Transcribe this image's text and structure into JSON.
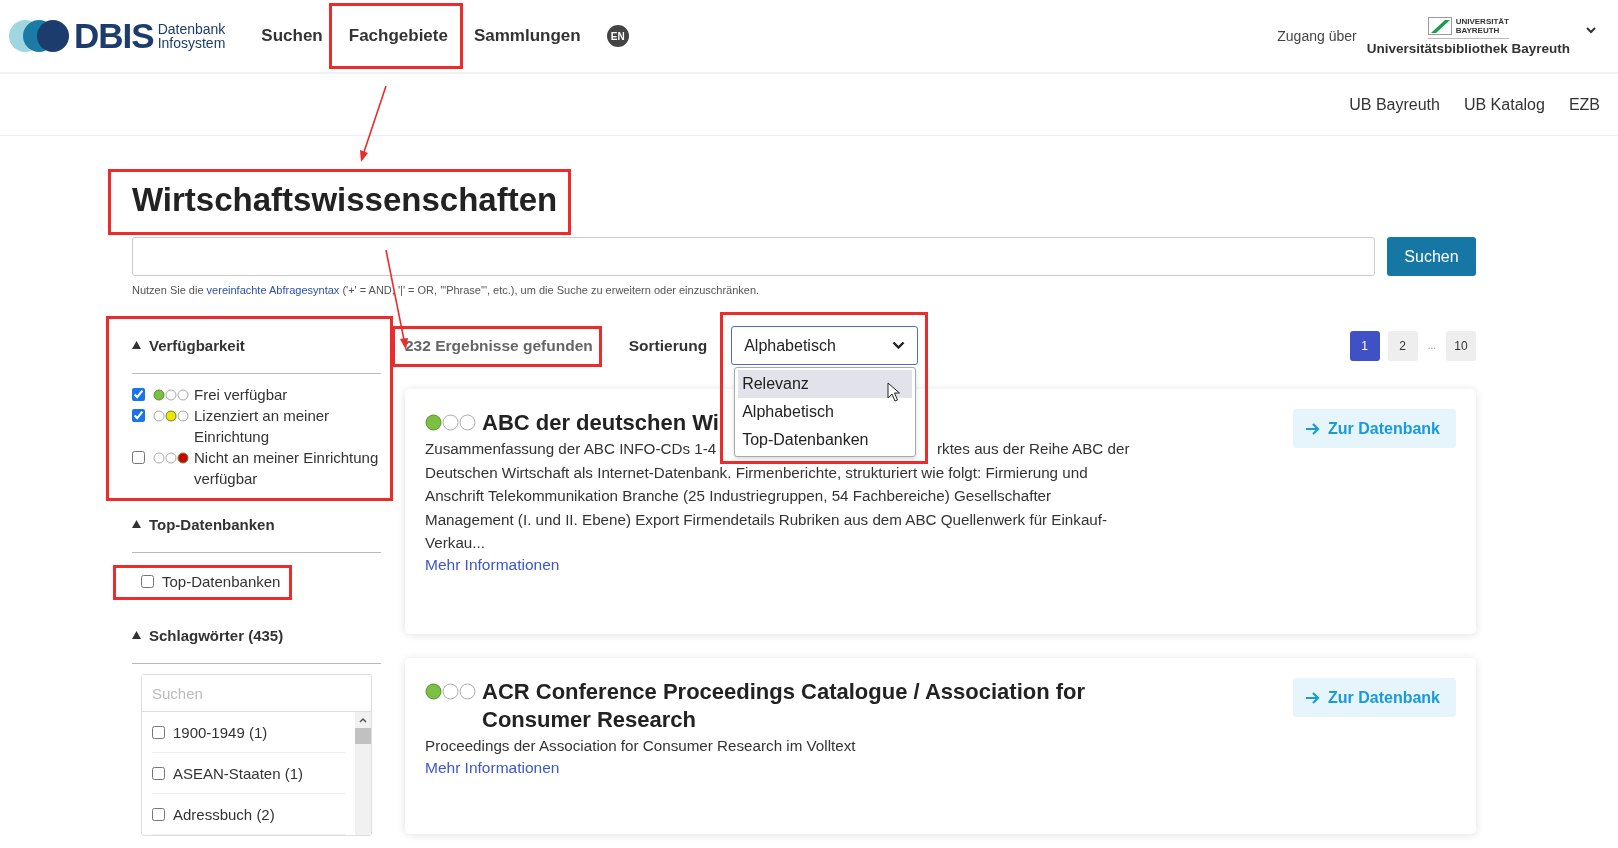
{
  "header": {
    "logo": {
      "name": "DBIS",
      "subtitle_lines": [
        "Datenbank",
        "Infosystem"
      ]
    },
    "nav": [
      {
        "label": "Suchen",
        "highlighted": false
      },
      {
        "label": "Fachgebiete",
        "highlighted": true
      },
      {
        "label": "Sammlungen",
        "highlighted": false
      }
    ],
    "language": "EN",
    "access": {
      "label": "Zugang über",
      "institution": "Universitätsbibliothek Bayreuth",
      "logo_lines": [
        "UNIVERSITÄT",
        "BAYREUTH"
      ]
    }
  },
  "subnav": [
    "UB Bayreuth",
    "UB Katalog",
    "EZB"
  ],
  "title": {
    "text": "Wirtschaftswissenschaften",
    "highlighted": true
  },
  "search": {
    "button": "Suchen",
    "hint": {
      "before": "Nutzen Sie die",
      "link": "vereinfachte Abfragesyntax",
      "after": "('+' = AND, '|' = OR, '\"Phrase\"', etc.), um die Suche zu erweitern oder einzuschränken."
    }
  },
  "filters": [
    {
      "kind": "availability",
      "title": "Verfügbarkeit",
      "expanded": true,
      "highlighted": true,
      "options": [
        {
          "label": "Frei verfügbar",
          "kind": "free",
          "checked": true
        },
        {
          "label": "Lizenziert an meiner Einrichtung",
          "kind": "licensed",
          "checked": true
        },
        {
          "label": "Nicht an meiner Einrichtung verfügbar",
          "kind": "none",
          "checked": false
        }
      ]
    },
    {
      "kind": "checkbox",
      "title": "Top-Datenbanken",
      "expanded": true,
      "highlighted": false,
      "options": [
        {
          "label": "Top-Datenbanken",
          "checked": false,
          "highlighted": true
        }
      ]
    },
    {
      "kind": "searchable-list",
      "title": "Schlagwörter (435)",
      "expanded": true,
      "highlighted": false,
      "placeholder": "Suchen",
      "options": [
        {
          "label": "1900-1949 (1)",
          "checked": false
        },
        {
          "label": "ASEAN-Staaten (1)",
          "checked": false
        },
        {
          "label": "Adressbuch (2)",
          "checked": false
        }
      ]
    }
  ],
  "results": {
    "count": "232 Ergebnisse gefunden",
    "highlighted": true
  },
  "sort": {
    "label": "Sortierung",
    "value": "Alphabetisch",
    "open": true,
    "highlighted": true,
    "options": [
      {
        "label": "Relevanz",
        "hovered": true
      },
      {
        "label": "Alphabetisch",
        "hovered": false
      },
      {
        "label": "Top-Datenbanken",
        "hovered": false
      }
    ]
  },
  "pagination": [
    {
      "kind": "page",
      "label": "1",
      "selected": true
    },
    {
      "kind": "page",
      "label": "2",
      "selected": false
    },
    {
      "kind": "ellipsis",
      "label": "..."
    },
    {
      "kind": "page",
      "label": "10",
      "selected": false
    }
  ],
  "databases": [
    {
      "kind": "free",
      "title": "ABC der deutschen Wi",
      "lines": [
        [
          "Zusammenfassung der ABC INFO-CDs 1-4",
          "rktes aus der Reihe ABC der"
        ],
        [
          "Deutschen Wirtschaft als Internet-Datenbank. Firmenberichte, strukturiert wie folgt: Firmierung und"
        ],
        [
          "Anschrift Telekommunikation Branche (25 Industriegruppen, 54 Fachbereiche) Gesellschafter"
        ],
        [
          "Management (I. und II. Ebene) Export Firmendetails Rubriken aus dem ABC Quellenwerk für Einkauf-"
        ],
        [
          "Verkau..."
        ]
      ],
      "more": "Mehr Informationen",
      "button": "Zur Datenbank"
    },
    {
      "kind": "free",
      "title": "ACR Conference Proceedings Catalogue / Association for Consumer Research",
      "lines": [
        [
          "Proceedings der Association for Consumer Research im Volltext"
        ]
      ],
      "more": "Mehr Informationen",
      "button": "Zur Datenbank"
    }
  ]
}
